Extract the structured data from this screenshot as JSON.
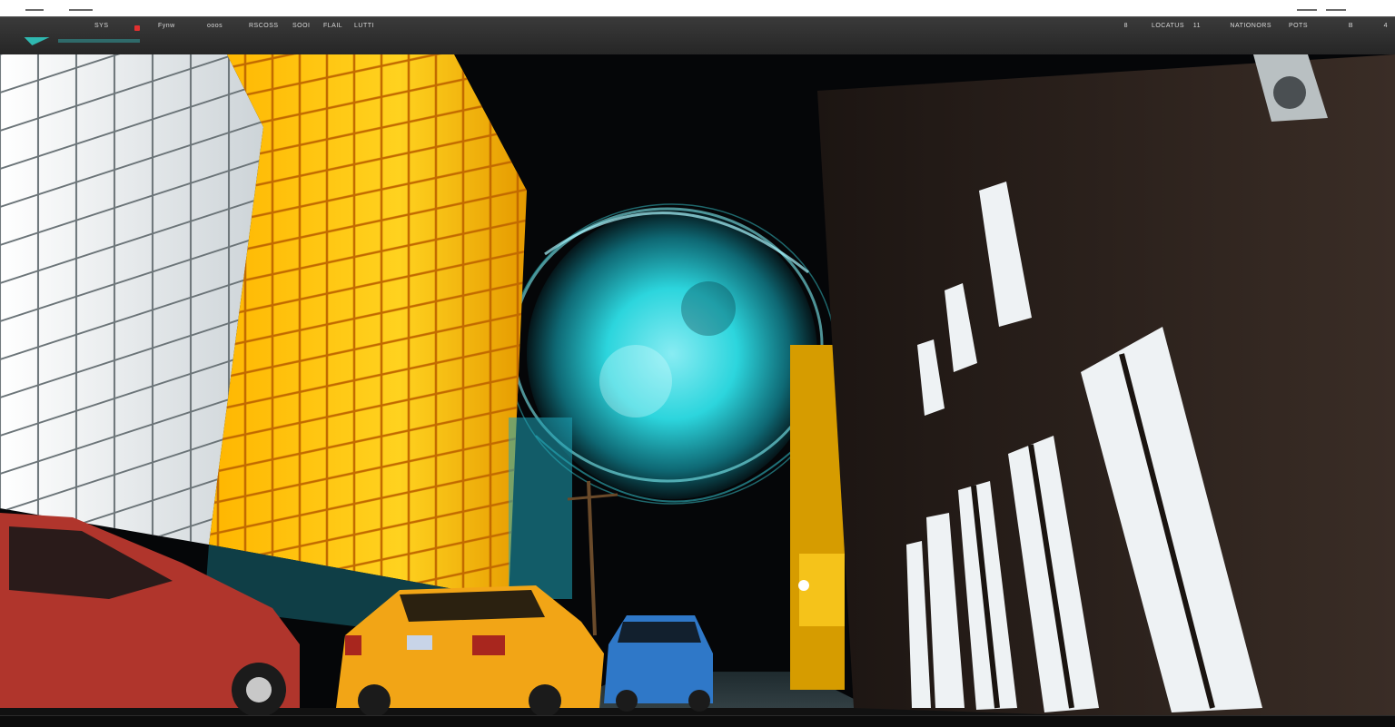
{
  "window": {
    "menu_items": [
      "SYS",
      "Fynw",
      "ooos",
      "RSCOSS",
      "SOOI",
      "FLAIL",
      "LUTTI"
    ],
    "right_items": [
      "8",
      "LOCATUS",
      "11",
      "NATIONORS",
      "POTS",
      "B",
      "4"
    ],
    "corner_right": "+"
  },
  "scene": {
    "description_colors": {
      "sky": "#050608",
      "portal": "#2ee0e8",
      "yellow_building": "#ffc21a",
      "white_building": "#e9eef0",
      "brick_building": "#2a1f1a",
      "taxi": "#f2a516",
      "red_car": "#b0352c",
      "blue_car": "#2f78c8"
    }
  }
}
